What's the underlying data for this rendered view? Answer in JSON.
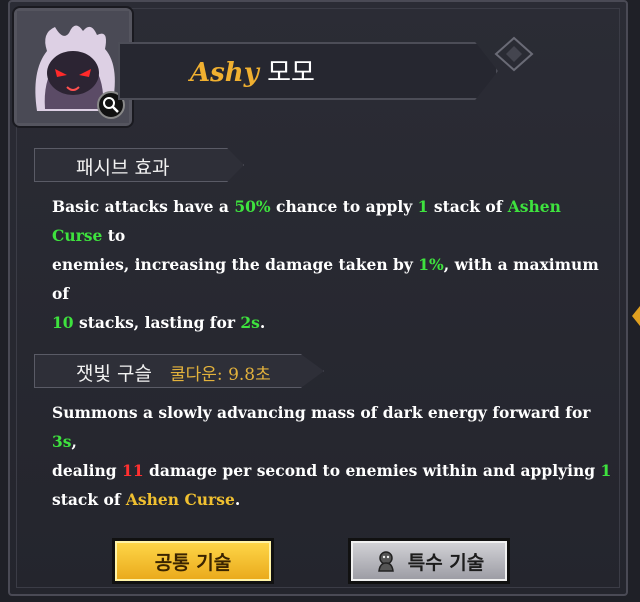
{
  "header": {
    "name_en": "Ashy",
    "name_ko": "모모"
  },
  "icons": {
    "portrait": "character-portrait",
    "zoom": "magnifier-icon",
    "special_skill": "spirit-icon"
  },
  "passive": {
    "title": "패시브 효과",
    "line1_a": "Basic attacks have a ",
    "line1_b": "50%",
    "line1_c": " chance to apply ",
    "line1_d": "1",
    "line1_e": " stack of ",
    "line1_f": "Ashen Curse",
    "line1_g": " to",
    "line2_a": "enemies, increasing the damage taken by ",
    "line2_b": "1%",
    "line2_c": ", with a maximum of",
    "line3_a": "10",
    "line3_b": " stacks, lasting for ",
    "line3_c": "2s",
    "line3_d": "."
  },
  "skill": {
    "title": "잿빛 구슬",
    "cooldown": "쿨다운: 9.8초",
    "line1_a": "Summons a slowly advancing mass of dark energy forward for ",
    "line1_b": "3s",
    "line1_c": ",",
    "line2_a": "dealing ",
    "line2_b": "11",
    "line2_c": " damage per second to enemies within and applying ",
    "line2_d": "1",
    "line3_a": "stack of ",
    "line3_b": "Ashen Curse",
    "line3_c": "."
  },
  "buttons": {
    "common": "공통 기술",
    "special": "특수 기술"
  },
  "colors": {
    "highlight_green": "#3ee23e",
    "highlight_yellow": "#f0c030",
    "highlight_red": "#ff3030",
    "button_gold": "#f2c232",
    "button_silver": "#bdbdc3"
  }
}
